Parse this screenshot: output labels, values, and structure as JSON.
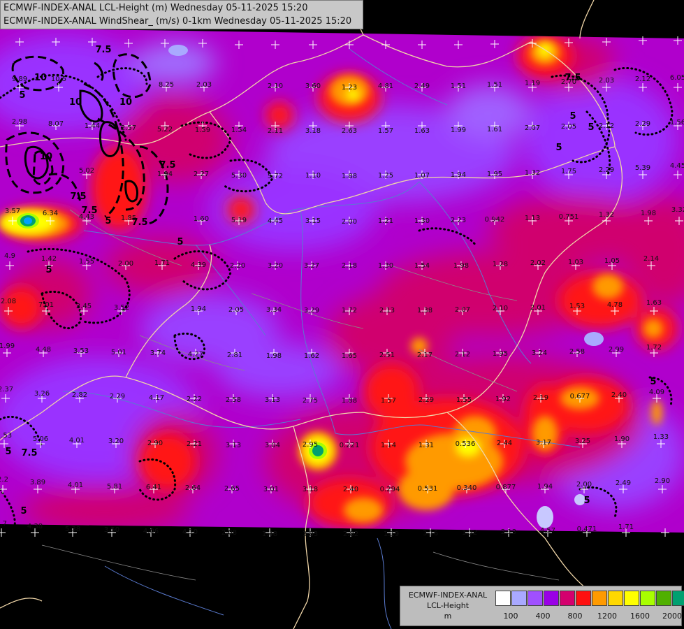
{
  "header": {
    "line1": "ECMWF-INDEX-ANAL LCL-Height (m) Wednesday 05-11-2025 15:20",
    "line2": "ECMWF-INDEX-ANAL WindShear_ (m/s) 0-1km Wednesday 05-11-2025 15:20"
  },
  "legend": {
    "title_line1": "ECMWF-INDEX-ANAL",
    "title_line2": "LCL-Height",
    "title_line3": "m",
    "colors": [
      "#ffffff",
      "#a9a9ff",
      "#a050ff",
      "#9a00e6",
      "#d4006e",
      "#ff1010",
      "#ff9a00",
      "#ffd800",
      "#ffff00",
      "#a8ff00",
      "#50b000",
      "#00a070",
      "#00a0ff"
    ],
    "labels": [
      "100",
      "400",
      "800",
      "1200",
      "1600",
      "2000"
    ]
  },
  "colors": {
    "background": "#000000",
    "border": "#f0d6a8",
    "river": "#5a7bd0",
    "contour": "#000000",
    "grid_marker": "#ffffff"
  },
  "station_values": [
    "9.89",
    "10.5",
    "8.25",
    "2.03",
    "2.10",
    "3.60",
    "1.23",
    "4.81",
    "2.49",
    "1.51",
    "1.51",
    "1.19",
    "2.70",
    "2.03",
    "2.12",
    "6.05",
    "2.98",
    "8.07",
    "1.44",
    "2.57",
    "5.22",
    "1.59",
    "1.54",
    "2.11",
    "3.18",
    "2.63",
    "1.57",
    "1.63",
    "1.99",
    "1.61",
    "2.07",
    "2.05",
    "2.12",
    "2.29",
    "1.56",
    "5.02",
    "1.94",
    "2.27",
    "5.30",
    "5.72",
    "1.10",
    "1.88",
    "1.25",
    "1.07",
    "1.94",
    "1.95",
    "1.32",
    "1.75",
    "2.29",
    "5.39",
    "4.45",
    "3.57",
    "6.34",
    "4.43",
    "1.85",
    "1.60",
    "5.19",
    "4.45",
    "3.15",
    "2.00",
    "1.21",
    "1.30",
    "2.23",
    "0.942",
    "1.13",
    "0.751",
    "1.32",
    "1.98",
    "3.32",
    "4.9",
    "1.42",
    "1.55",
    "2.00",
    "1.71",
    "4.39",
    "2.20",
    "3.20",
    "3.27",
    "2.18",
    "1.30",
    "1.54",
    "1.98",
    "1.28",
    "2.02",
    "1.03",
    "1.05",
    "2.14",
    "2.08",
    "7.01",
    "2.45",
    "3.52",
    "1.94",
    "2.05",
    "3.34",
    "3.29",
    "1.72",
    "2.13",
    "1.38",
    "2.07",
    "2.10",
    "2.01",
    "1.53",
    "4.78",
    "1.63",
    "1.99",
    "4.48",
    "3.53",
    "5.01",
    "3.74",
    "4.27",
    "2.81",
    "1.98",
    "1.62",
    "1.65",
    "2.51",
    "2.17",
    "2.12",
    "1.95",
    "3.24",
    "2.58",
    "2.99",
    "1.72",
    "2.37",
    "3.26",
    "2.82",
    "2.29",
    "4.17",
    "2.22",
    "2.58",
    "3.13",
    "2.75",
    "1.88",
    "1.57",
    "2.29",
    "1.55",
    "1.92",
    "2.19",
    "0.677",
    "2.40",
    "4.09",
    "1.53",
    "5.06",
    "4.01",
    "3.20",
    "2.90",
    "2.21",
    "3.13",
    "3.04",
    "2.95",
    "0.221",
    "1.14",
    "1.31",
    "0.536",
    "2.44",
    "3.17",
    "3.25",
    "1.90",
    "1.33",
    "2.2",
    "3.89",
    "4.01",
    "5.81",
    "6.41",
    "2.64",
    "2.65",
    "3.01",
    "3.18",
    "2.40",
    "0.294",
    "0.531",
    "0.340",
    "0.877",
    "1.94",
    "2.00",
    "2.49",
    "2.90",
    "3.7",
    "4.38",
    "5.38",
    "3.50",
    "4.06",
    "4.10",
    "2.08",
    "1.48",
    "3.83",
    "2.82",
    "1.19",
    "3.16",
    "1.32",
    "2.13",
    "4.57",
    "0.471",
    "1.71"
  ],
  "contour_labels": [
    "10",
    "10",
    "7.5",
    "5",
    "10",
    "7.5",
    "10",
    "7.5",
    "5",
    "7.5",
    "5",
    "5",
    "7.5",
    "5",
    "7.5",
    "5",
    "5",
    "5",
    "5",
    "5",
    "7.5",
    "5"
  ]
}
